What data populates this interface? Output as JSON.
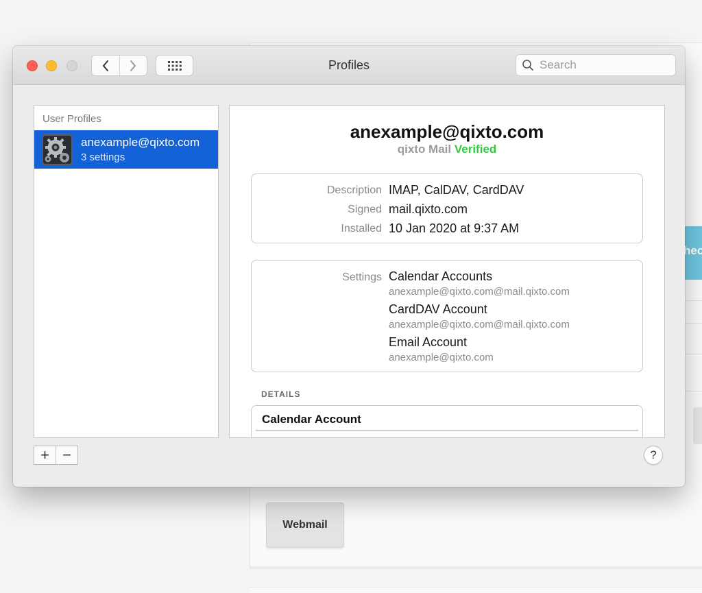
{
  "window": {
    "title": "Profiles",
    "search_placeholder": "Search"
  },
  "sidebar": {
    "header": "User Profiles",
    "items": [
      {
        "name": "anexample@qixto.com",
        "subtitle": "3 settings",
        "icon": "gear-icon",
        "selected": true
      }
    ]
  },
  "profile": {
    "title": "anexample@qixto.com",
    "source": "qixto Mail",
    "status": "Verified",
    "status_color": "#34c840",
    "info": [
      {
        "label": "Description",
        "value": "IMAP, CalDAV, CardDAV"
      },
      {
        "label": "Signed",
        "value": "mail.qixto.com"
      },
      {
        "label": "Installed",
        "value": "10 Jan 2020 at 9:37 AM"
      }
    ],
    "settings_label": "Settings",
    "settings": [
      {
        "name": "Calendar Accounts",
        "detail": "anexample@qixto.com@mail.qixto.com"
      },
      {
        "name": "CardDAV Account",
        "detail": "anexample@qixto.com@mail.qixto.com"
      },
      {
        "name": "Email Account",
        "detail": "anexample@qixto.com"
      }
    ],
    "details_header": "DETAILS",
    "details_first_title": "Calendar Account"
  },
  "footer": {
    "add_label": "+",
    "remove_label": "−",
    "help_label": "?"
  },
  "background": {
    "webmail_label": "Webmail",
    "teal_button_fragment": "hec"
  },
  "colors": {
    "selection": "#1462d8",
    "close": "#fe5f57",
    "minimize": "#febc2e"
  }
}
